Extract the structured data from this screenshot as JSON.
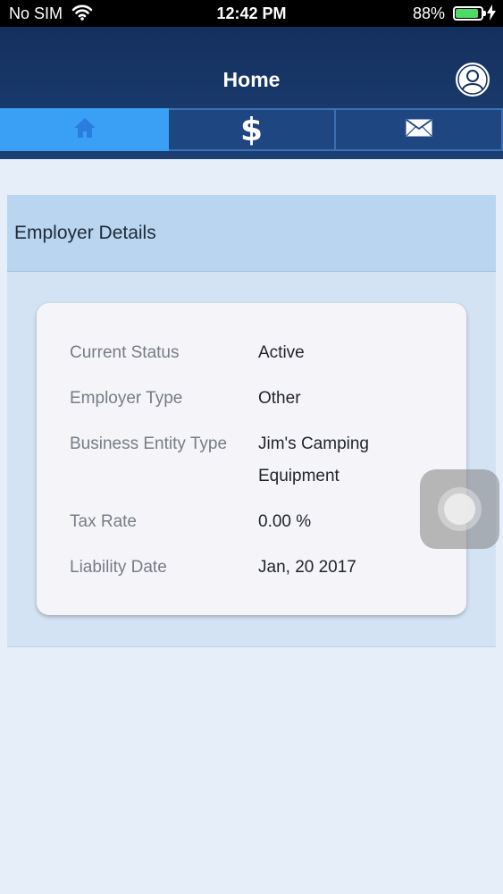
{
  "status_bar": {
    "carrier": "No SIM",
    "time": "12:42 PM",
    "battery_percent": "88%",
    "battery_level": 0.88,
    "battery_color": "#4cd964",
    "icons": [
      "wifi-icon",
      "battery-icon",
      "charging-bolt-icon"
    ]
  },
  "header": {
    "title": "Home",
    "profile_icon": "user-profile-icon",
    "background": "#14305e"
  },
  "tabs": [
    {
      "icon": "home-icon",
      "active": true
    },
    {
      "icon": "dollar-icon",
      "label": "$",
      "active": false
    },
    {
      "icon": "mail-icon",
      "active": false
    }
  ],
  "employer": {
    "section_title": "Employer Details",
    "rows": [
      {
        "label": "Current Status",
        "value": "Active"
      },
      {
        "label": "Employer Type",
        "value": "Other"
      },
      {
        "label": "Business Entity Type",
        "value": "Jim's Camping Equipment"
      },
      {
        "label": "Tax Rate",
        "value": "0.00 %"
      },
      {
        "label": "Liability Date",
        "value": "Jan, 20 2017"
      }
    ]
  },
  "colors": {
    "accent": "#3aa0f5",
    "tab_bg": "#1e4680",
    "page_bg": "#e6eef9"
  }
}
